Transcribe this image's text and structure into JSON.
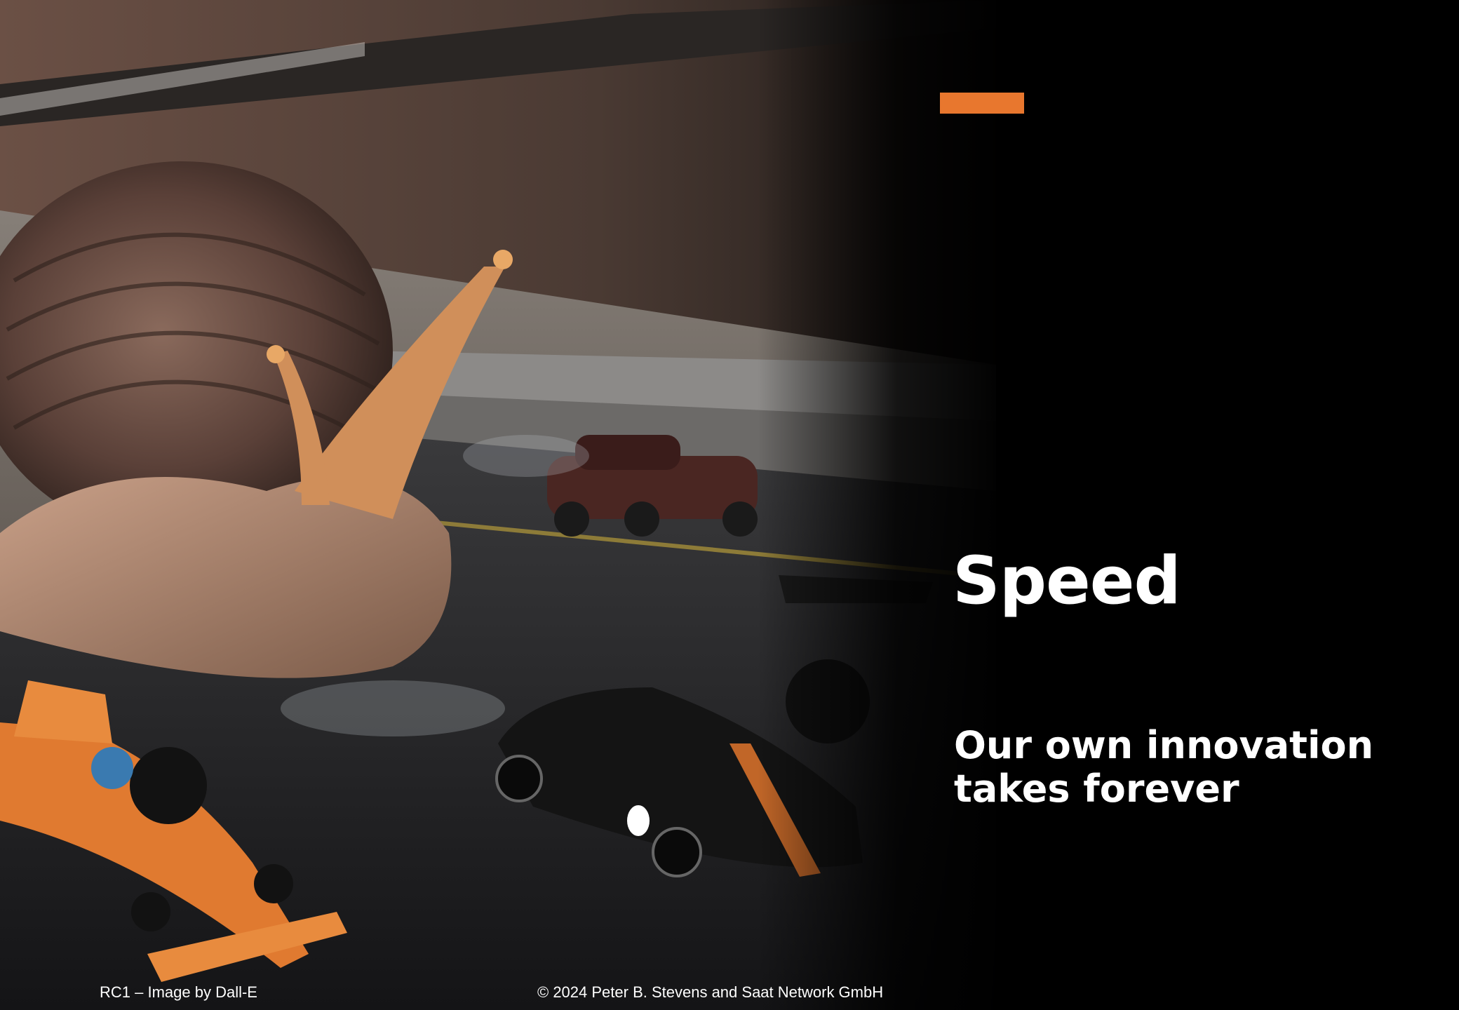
{
  "slide": {
    "title": "Speed",
    "subtitle_lines": [
      "Our own innovation",
      "takes forever"
    ],
    "accent_color": "#E8772E",
    "background_color": "#000000"
  },
  "footer": {
    "caption": "RC1 – Image by Dall-E",
    "copyright": "© 2024 Peter B. Stevens and Saat Network GmbH"
  },
  "image": {
    "description_icon": "snail-drag-race-photo"
  }
}
